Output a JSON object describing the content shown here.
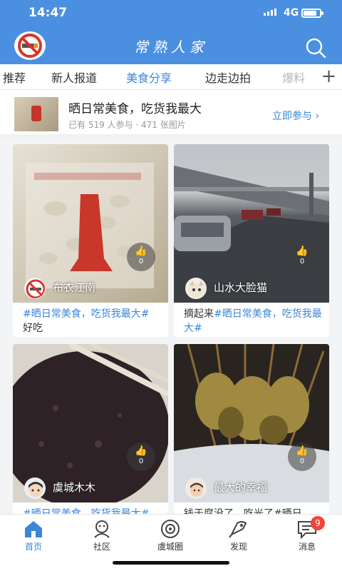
{
  "status_bar": {
    "time": "14:47",
    "network": "4G"
  },
  "header": {
    "title": "常熟人家"
  },
  "tabs": [
    {
      "label": "推荐"
    },
    {
      "label": "新人报道"
    },
    {
      "label": "美食分享",
      "active": true
    },
    {
      "label": "边走边拍"
    },
    {
      "label": "爆料"
    }
  ],
  "topic": {
    "title": "晒日常美食，吃货我最大",
    "meta": "已有 519 人参与 · 471 张图片",
    "join_label": "立即参与"
  },
  "posts": [
    {
      "user": "布衣江南",
      "likes": "0",
      "tag": "#晒日常美食，吃货我最大#",
      "text": "好吃",
      "image": "pistachio-bag",
      "avatar": "no-smoking-avatar"
    },
    {
      "user": "山水大脸猫",
      "likes": "0",
      "tag": "#晒日常美食，吃货我最大#",
      "text_before": "摘起来",
      "image": "rainy-highway",
      "avatar": "cat-avatar"
    },
    {
      "user": "虞城木木",
      "likes": "0",
      "desc": "#晒日常美食，吃货我最大#",
      "image": "black-rice-porridge",
      "avatar": "cartoon-avatar"
    },
    {
      "user": "最大的幸福",
      "likes": "0",
      "desc": "钱于腐没了，吃光了#晒日",
      "image": "fried-skewers",
      "avatar": "child-avatar"
    }
  ],
  "bottom_nav": [
    {
      "label": "首页",
      "icon": "home-icon",
      "active": true
    },
    {
      "label": "社区",
      "icon": "community-icon"
    },
    {
      "label": "虞城圈",
      "icon": "circle-icon"
    },
    {
      "label": "发现",
      "icon": "discover-icon"
    },
    {
      "label": "消息",
      "icon": "message-icon",
      "badge": "9"
    }
  ],
  "colors": {
    "brand": "#4a8fe0",
    "accent": "#3a87d9",
    "badge": "#ef4638"
  }
}
